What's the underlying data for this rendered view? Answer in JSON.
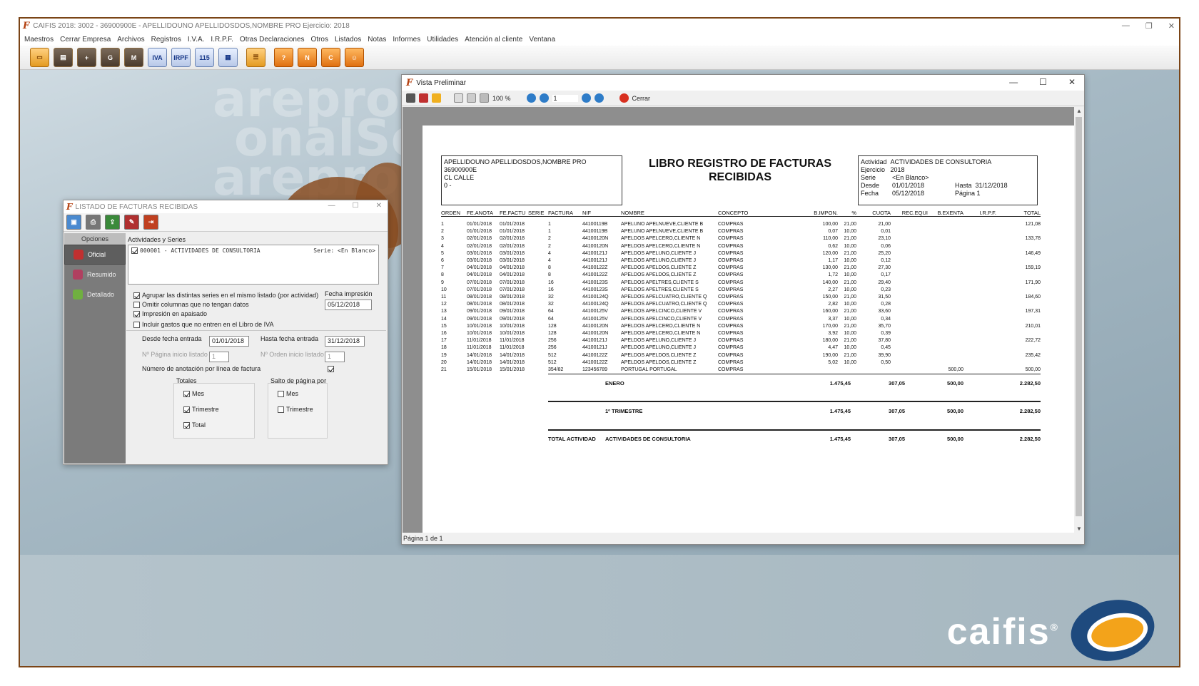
{
  "app": {
    "title": "CAIFIS 2018: 3002 - 36900900E - APELLIDOUNO APELLIDOSDOS,NOMBRE PRO   Ejercicio: 2018",
    "menu": [
      "Maestros",
      "Cerrar Empresa",
      "Archivos",
      "Registros",
      "I.V.A.",
      "I.R.P.F.",
      "Otras Declaraciones",
      "Otros",
      "Listados",
      "Notas",
      "Informes",
      "Utilidades",
      "Atención al cliente",
      "Ventana"
    ],
    "toolbar": [
      "IVA",
      "IRPF",
      "115"
    ],
    "watermark": [
      "areprofes",
      "onalSoft",
      "areprofe"
    ],
    "brand": "caifis",
    "brand_mark": "®"
  },
  "listado": {
    "title": "LISTADO DE FACTURAS RECIBIDAS",
    "sidebar_header": "Opciones",
    "sidebar_items": [
      "Oficial",
      "Resumido",
      "Detallado"
    ],
    "activities_label": "Actividades y Series",
    "activity_line": "000001 - ACTIVIDADES DE CONSULTORIA",
    "activity_series": "Serie: <En Blanco>",
    "opt_agrupar": "Agrupar las distintas series en el mismo listado (por actividad)",
    "opt_omitir": "Omitir columnas que no tengan datos",
    "opt_apaisado": "Impresión en apaisado",
    "opt_gastos": "Incluir gastos que no entren en el Libro de IVA",
    "fecha_impresion_label": "Fecha impresión",
    "fecha_impresion": "05/12/2018",
    "desde_label": "Desde fecha entrada",
    "desde": "01/01/2018",
    "hasta_label": "Hasta fecha entrada",
    "hasta": "31/12/2018",
    "pagina_label": "Nº Página inicio listado",
    "pagina": "1",
    "orden_label": "Nº Orden inicio listado",
    "orden": "1",
    "numero_label": "Número de anotación por línea de factura",
    "totales_label": "Totales",
    "salto_label": "Salto de página por",
    "mes": "Mes",
    "trimestre": "Trimestre",
    "total": "Total"
  },
  "vista": {
    "title": "Vista Preliminar",
    "zoom": "100 %",
    "page_input": "1",
    "close": "Cerrar",
    "status": "Página 1 de 1"
  },
  "report": {
    "left_header": [
      "APELLIDOUNO APELLIDOSDOS,NOMBRE PRO",
      "36900900E",
      "CL CALLE",
      "0 -"
    ],
    "title_1": "LIBRO REGISTRO DE FACTURAS",
    "title_2": "RECIBIDAS",
    "actividad_label": "Actividad",
    "actividad": "ACTIVIDADES DE CONSULTORIA",
    "ejercicio_label": "Ejercicio",
    "ejercicio": "2018",
    "serie_label": "Serie",
    "serie": "<En Blanco>",
    "desde_label": "Desde",
    "desde": "01/01/2018",
    "hasta_label": "Hasta",
    "hasta": "31/12/2018",
    "fecha_label": "Fecha",
    "fecha": "05/12/2018",
    "pagina": "Página 1",
    "columns": [
      "ORDEN",
      "FE.ANOTA",
      "FE.FACTU",
      "SERIE",
      "FACTURA",
      "NIF",
      "NOMBRE",
      "CONCEPTO",
      "B.IMPON.",
      "%",
      "CUOTA",
      "REC.EQUI",
      "B.EXENTA",
      "I.R.P.F.",
      "TOTAL"
    ],
    "rows": [
      [
        "1",
        "01/01/2018",
        "01/01/2018",
        "",
        "1",
        "44100119B",
        "APELUNO APELNUEVE,CLIENTE B",
        "COMPRAS",
        "100,00",
        "21,00",
        "21,00",
        "",
        "",
        "",
        "121,08"
      ],
      [
        "2",
        "01/01/2018",
        "01/01/2018",
        "",
        "1",
        "44100119B",
        "APELUNO APELNUEVE,CLIENTE B",
        "COMPRAS",
        "0,07",
        "10,00",
        "0,01",
        "",
        "",
        "",
        ""
      ],
      [
        "3",
        "02/01/2018",
        "02/01/2018",
        "",
        "2",
        "44100120N",
        "APELDOS APELCERO,CLIENTE N",
        "COMPRAS",
        "110,00",
        "21,00",
        "23,10",
        "",
        "",
        "",
        "133,78"
      ],
      [
        "4",
        "02/01/2018",
        "02/01/2018",
        "",
        "2",
        "44100120N",
        "APELDOS APELCERO,CLIENTE N",
        "COMPRAS",
        "0,62",
        "10,00",
        "0,06",
        "",
        "",
        "",
        ""
      ],
      [
        "5",
        "03/01/2018",
        "03/01/2018",
        "",
        "4",
        "44100121J",
        "APELDOS APELUNO,CLIENTE J",
        "COMPRAS",
        "120,00",
        "21,00",
        "25,20",
        "",
        "",
        "",
        "146,49"
      ],
      [
        "6",
        "03/01/2018",
        "03/01/2018",
        "",
        "4",
        "44100121J",
        "APELDOS APELUNO,CLIENTE J",
        "COMPRAS",
        "1,17",
        "10,00",
        "0,12",
        "",
        "",
        "",
        ""
      ],
      [
        "7",
        "04/01/2018",
        "04/01/2018",
        "",
        "8",
        "44100122Z",
        "APELDOS APELDOS,CLIENTE Z",
        "COMPRAS",
        "130,00",
        "21,00",
        "27,30",
        "",
        "",
        "",
        "159,19"
      ],
      [
        "8",
        "04/01/2018",
        "04/01/2018",
        "",
        "8",
        "44100122Z",
        "APELDOS APELDOS,CLIENTE Z",
        "COMPRAS",
        "1,72",
        "10,00",
        "0,17",
        "",
        "",
        "",
        ""
      ],
      [
        "9",
        "07/01/2018",
        "07/01/2018",
        "",
        "16",
        "44100123S",
        "APELDOS APELTRES,CLIENTE S",
        "COMPRAS",
        "140,00",
        "21,00",
        "29,40",
        "",
        "",
        "",
        "171,90"
      ],
      [
        "10",
        "07/01/2018",
        "07/01/2018",
        "",
        "16",
        "44100123S",
        "APELDOS APELTRES,CLIENTE S",
        "COMPRAS",
        "2,27",
        "10,00",
        "0,23",
        "",
        "",
        "",
        ""
      ],
      [
        "11",
        "08/01/2018",
        "08/01/2018",
        "",
        "32",
        "44100124Q",
        "APELDOS APELCUATRO,CLIENTE Q",
        "COMPRAS",
        "150,00",
        "21,00",
        "31,50",
        "",
        "",
        "",
        "184,60"
      ],
      [
        "12",
        "08/01/2018",
        "08/01/2018",
        "",
        "32",
        "44100124Q",
        "APELDOS APELCUATRO,CLIENTE Q",
        "COMPRAS",
        "2,82",
        "10,00",
        "0,28",
        "",
        "",
        "",
        ""
      ],
      [
        "13",
        "09/01/2018",
        "09/01/2018",
        "",
        "64",
        "44100125V",
        "APELDOS APELCINCO,CLIENTE V",
        "COMPRAS",
        "160,00",
        "21,00",
        "33,60",
        "",
        "",
        "",
        "197,31"
      ],
      [
        "14",
        "09/01/2018",
        "09/01/2018",
        "",
        "64",
        "44100125V",
        "APELDOS APELCINCO,CLIENTE V",
        "COMPRAS",
        "3,37",
        "10,00",
        "0,34",
        "",
        "",
        "",
        ""
      ],
      [
        "15",
        "10/01/2018",
        "10/01/2018",
        "",
        "128",
        "44100120N",
        "APELDOS APELCERO,CLIENTE N",
        "COMPRAS",
        "170,00",
        "21,00",
        "35,70",
        "",
        "",
        "",
        "210,01"
      ],
      [
        "16",
        "10/01/2018",
        "10/01/2018",
        "",
        "128",
        "44100120N",
        "APELDOS APELCERO,CLIENTE N",
        "COMPRAS",
        "3,92",
        "10,00",
        "0,39",
        "",
        "",
        "",
        ""
      ],
      [
        "17",
        "11/01/2018",
        "11/01/2018",
        "",
        "256",
        "44100121J",
        "APELDOS APELUNO,CLIENTE J",
        "COMPRAS",
        "180,00",
        "21,00",
        "37,80",
        "",
        "",
        "",
        "222,72"
      ],
      [
        "18",
        "11/01/2018",
        "11/01/2018",
        "",
        "256",
        "44100121J",
        "APELDOS APELUNO,CLIENTE J",
        "COMPRAS",
        "4,47",
        "10,00",
        "0,45",
        "",
        "",
        "",
        ""
      ],
      [
        "19",
        "14/01/2018",
        "14/01/2018",
        "",
        "512",
        "44100122Z",
        "APELDOS APELDOS,CLIENTE Z",
        "COMPRAS",
        "190,00",
        "21,00",
        "39,90",
        "",
        "",
        "",
        "235,42"
      ],
      [
        "20",
        "14/01/2018",
        "14/01/2018",
        "",
        "512",
        "44100122Z",
        "APELDOS APELDOS,CLIENTE Z",
        "COMPRAS",
        "5,02",
        "10,00",
        "0,50",
        "",
        "",
        "",
        ""
      ],
      [
        "21",
        "15/01/2018",
        "15/01/2018",
        "",
        "354/82",
        "123456789",
        "PORTUGAL PORTUGAL",
        "COMPRAS",
        "",
        "",
        "",
        "",
        "500,00",
        "",
        "500,00"
      ]
    ],
    "totals": [
      {
        "label1": "",
        "label2": "ENERO",
        "bimpon": "1.475,45",
        "cuota": "307,05",
        "exenta": "500,00",
        "total": "2.282,50"
      },
      {
        "label1": "",
        "label2": "1º TRIMESTRE",
        "bimpon": "1.475,45",
        "cuota": "307,05",
        "exenta": "500,00",
        "total": "2.282,50"
      },
      {
        "label1": "TOTAL ACTIVIDAD",
        "label2": "ACTIVIDADES DE CONSULTORIA",
        "bimpon": "1.475,45",
        "cuota": "307,05",
        "exenta": "500,00",
        "total": "2.282,50"
      }
    ]
  }
}
